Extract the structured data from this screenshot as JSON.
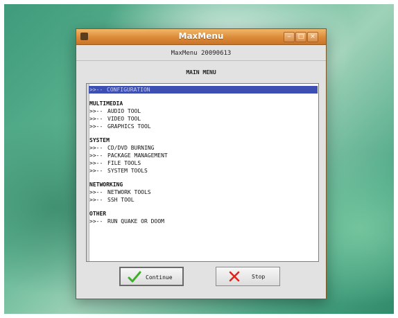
{
  "window": {
    "title": "MaxMenu",
    "controls": {
      "minimize": "–",
      "maximize": "□",
      "close": "×"
    },
    "accent_color": "#dc8a38"
  },
  "header": {
    "version": "MaxMenu 20090613",
    "menu_heading": "MAIN MENU"
  },
  "menu": {
    "selected_color": "#3e4fb4",
    "items": [
      {
        "type": "entry",
        "arrow": ">>--",
        "label": "CONFIGURATION",
        "selected": true
      },
      {
        "type": "category",
        "label": "MULTIMEDIA"
      },
      {
        "type": "entry",
        "arrow": ">>--",
        "label": "AUDIO TOOL"
      },
      {
        "type": "entry",
        "arrow": ">>--",
        "label": "VIDEO TOOL"
      },
      {
        "type": "entry",
        "arrow": ">>--",
        "label": "GRAPHICS TOOL"
      },
      {
        "type": "category",
        "label": "SYSTEM"
      },
      {
        "type": "entry",
        "arrow": ">>--",
        "label": "CD/DVD BURNING"
      },
      {
        "type": "entry",
        "arrow": ">>--",
        "label": "PACKAGE MANAGEMENT"
      },
      {
        "type": "entry",
        "arrow": ">>--",
        "label": "FILE TOOLS"
      },
      {
        "type": "entry",
        "arrow": ">>--",
        "label": "SYSTEM TOOLS"
      },
      {
        "type": "category",
        "label": "NETWORKING"
      },
      {
        "type": "entry",
        "arrow": ">>--",
        "label": "NETWORK TOOLS"
      },
      {
        "type": "entry",
        "arrow": ">>--",
        "label": "SSH TOOL"
      },
      {
        "type": "category",
        "label": "OTHER"
      },
      {
        "type": "entry",
        "arrow": ">>--",
        "label": "RUN QUAKE OR DOOM"
      }
    ]
  },
  "buttons": {
    "continue_label": "Continue",
    "continue_icon": "check-icon",
    "stop_label": "Stop",
    "stop_icon": "x-icon"
  }
}
